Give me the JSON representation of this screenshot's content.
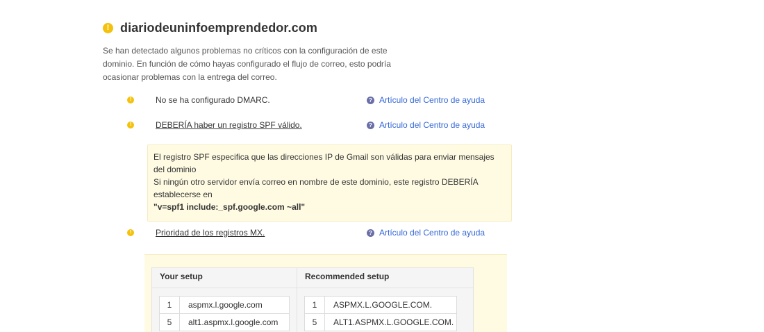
{
  "header": {
    "domain": "diariodeuninfoemprendedor.com"
  },
  "intro": {
    "text": "Se han detectado algunos problemas no críticos con la configuración de este dominio. En función de cómo hayas configurado el flujo de correo, esto podría ocasionar problemas con la entrega del correo."
  },
  "issues": [
    {
      "text": "No se ha configurado DMARC.",
      "help": "Artículo del Centro de ayuda",
      "icon": "warning-icon"
    },
    {
      "text": "DEBERÍA haber un registro SPF válido.",
      "help": "Artículo del Centro de ayuda",
      "icon": "warning-icon"
    },
    {
      "text": "Prioridad de los registros MX.",
      "help": "Artículo del Centro de ayuda",
      "icon": "warning-icon"
    }
  ],
  "spf": {
    "line1": "El registro SPF especifica que las direcciones IP de Gmail son válidas para enviar mensajes del dominio",
    "line2": "Si ningún otro servidor envía correo en nombre de este dominio, este registro DEBERÍA establecerse en",
    "record": "\"v=spf1 include:_spf.google.com ~all\""
  },
  "mx": {
    "your_setup_header": "Your setup",
    "recommended_header": "Recommended setup",
    "your_setup": [
      {
        "priority": "1",
        "host": "aspmx.l.google.com"
      },
      {
        "priority": "5",
        "host": "alt1.aspmx.l.google.com"
      }
    ],
    "recommended": [
      {
        "priority": "1",
        "host": "ASPMX.L.GOOGLE.COM."
      },
      {
        "priority": "5",
        "host": "ALT1.ASPMX.L.GOOGLE.COM."
      }
    ]
  },
  "colors": {
    "warning": "#f4c20d",
    "link": "#3367d6",
    "help_icon": "#6a6fa8",
    "notice_bg": "#fffbe3"
  }
}
